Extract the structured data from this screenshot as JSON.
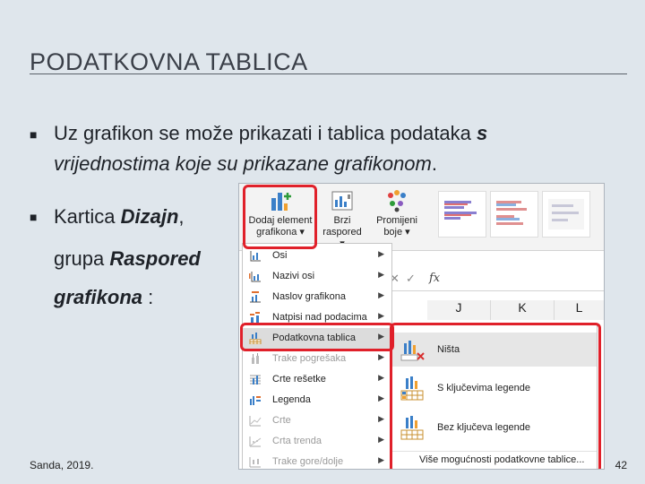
{
  "slide": {
    "title": "PODATKOVNA TABLICA",
    "bullet1": {
      "plain": "Uz grafikon se može prikazati i tablica podataka ",
      "s": "s",
      "italic": "vrijednostima koje su prikazane grafikonom",
      "end": "."
    },
    "bullet2": {
      "prefix": "Kartica ",
      "dizajn": "Dizajn",
      "comma": ",",
      "grupa": "grupa ",
      "raspored": "Raspored",
      "grafikona": "grafikona",
      "colon": " :"
    },
    "footer": "Sanda, 2019.",
    "page_number": "42"
  },
  "excel": {
    "ribbon": {
      "add_element": {
        "line1": "Dodaj element",
        "line2": "grafikona"
      },
      "quick_layout": {
        "line1": "Brzi",
        "line2": "raspored"
      },
      "change_colors": {
        "line1": "Promijeni",
        "line2": "boje"
      }
    },
    "formula_bar": {
      "fx": "fx"
    },
    "columns": [
      "J",
      "K",
      "L"
    ],
    "menu": [
      {
        "label": "Osi",
        "enabled": true,
        "icon": "axes-icon"
      },
      {
        "label": "Nazivi osi",
        "enabled": true,
        "icon": "axis-titles-icon"
      },
      {
        "label": "Naslov grafikona",
        "enabled": true,
        "icon": "chart-title-icon"
      },
      {
        "label": "Natpisi nad podacima",
        "enabled": true,
        "icon": "data-labels-icon"
      },
      {
        "label": "Podatkovna tablica",
        "enabled": true,
        "icon": "data-table-icon",
        "highlighted": true
      },
      {
        "label": "Trake pogrešaka",
        "enabled": false,
        "icon": "error-bars-icon"
      },
      {
        "label": "Crte rešetke",
        "enabled": true,
        "icon": "gridlines-icon"
      },
      {
        "label": "Legenda",
        "enabled": true,
        "icon": "legend-icon"
      },
      {
        "label": "Crte",
        "enabled": false,
        "icon": "lines-icon"
      },
      {
        "label": "Crta trenda",
        "enabled": false,
        "icon": "trendline-icon"
      },
      {
        "label": "Trake gore/dolje",
        "enabled": false,
        "icon": "up-down-bars-icon"
      }
    ],
    "submenu": {
      "items": [
        {
          "label": "Ništa",
          "icon": "no-table-icon"
        },
        {
          "label": "S ključevima legende",
          "icon": "table-with-keys-icon"
        },
        {
          "label": "Bez ključeva legende",
          "icon": "table-no-keys-icon"
        }
      ],
      "more": "Više mogućnosti podatkovne tablice..."
    }
  },
  "colors": {
    "highlight": "#e0202a",
    "menu_hover": "#dcdcdc",
    "slide_bg": "#dfe6ec"
  }
}
